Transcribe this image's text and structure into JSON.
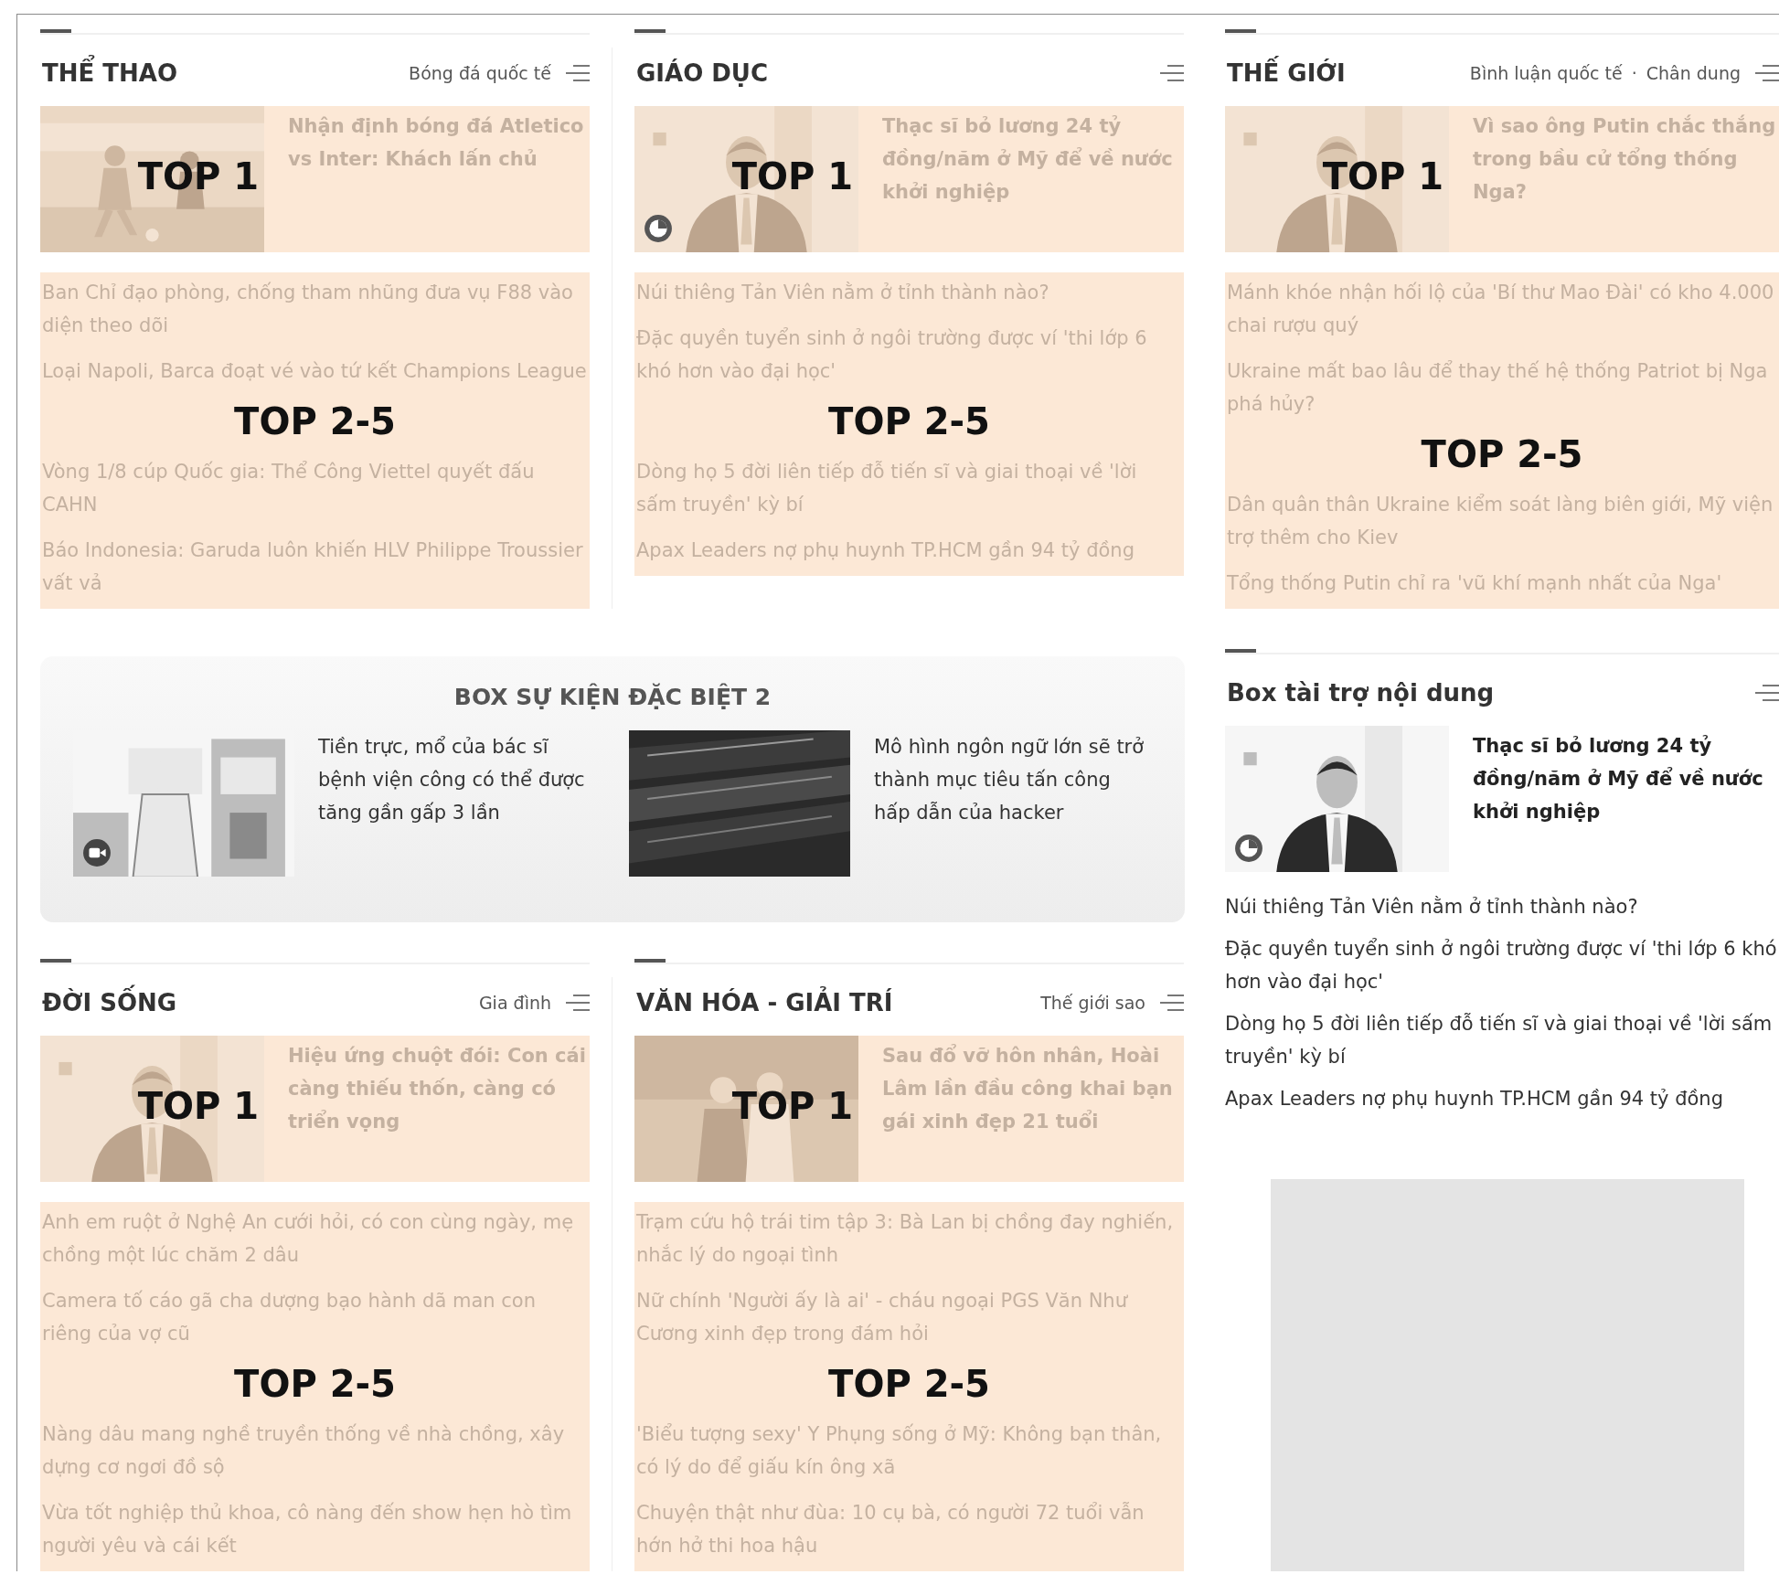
{
  "top_sections": [
    {
      "title": "THỂ THAO",
      "links": [
        "Bóng đá quốc tế"
      ],
      "top_story": {
        "headline": "Nhận định bóng đá Atletico vs Inter: Khách lấn chủ",
        "top_label": "TOP 1"
      },
      "list_label": "TOP 2-5",
      "stories": [
        "Ban Chỉ đạo phòng, chống tham nhũng đưa vụ F88 vào diện theo dõi",
        "Loại Napoli, Barca đoạt vé vào tứ kết Champions League",
        "Vòng 1/8 cúp Quốc gia: Thể Công Viettel quyết đấu CAHN",
        "Báo Indonesia: Garuda luôn khiến HLV Philippe Troussier vất vả"
      ]
    },
    {
      "title": "GIÁO DỤC",
      "top_story": {
        "headline": "Thạc sĩ bỏ lương 24 tỷ đồng/năm ở Mỹ để về nước khởi nghiệp",
        "top_label": "TOP 1",
        "badge": {
          "kind": "clock"
        }
      },
      "list_label": "TOP 2-5",
      "stories": [
        "Núi thiêng Tản Viên nằm ở tỉnh thành nào?",
        "Đặc quyền tuyển sinh ở ngôi trường được ví 'thi lớp 6 khó hơn vào đại học'",
        "Dòng họ 5 đời liên tiếp đỗ tiến sĩ và giai thoại về 'lời sấm truyền' kỳ bí",
        "Apax Leaders nợ phụ huynh TP.HCM gần 94 tỷ đồng"
      ]
    },
    {
      "title": "THẾ GIỚI",
      "links": [
        "Bình luận quốc tế",
        "Chân dung"
      ],
      "link_separator": "·",
      "top_story": {
        "headline": "Vì sao ông Putin chắc thắng trong bầu cử tổng thống Nga?",
        "top_label": "TOP 1"
      },
      "list_label": "TOP 2-5",
      "stories": [
        "Mánh khóe nhận hối lộ của 'Bí thư Mao Đài' có kho 4.000 chai rượu quý",
        "Ukraine mất bao lâu để thay thế hệ thống Patriot bị Nga phá hủy?",
        "Dân quân thân Ukraine kiểm soát làng biên giới, Mỹ viện trợ thêm cho Kiev",
        "Tổng thống Putin chỉ ra 'vũ khí mạnh nhất của Nga'"
      ]
    }
  ],
  "event_box": {
    "title": "BOX SỰ KIỆN ĐẶC BIỆT 2",
    "items": [
      {
        "headline": "Tiền trực, mổ của bác sĩ bệnh viện công có thể được tăng gần gấp 3 lần",
        "badge": {
          "kind": "video"
        }
      },
      {
        "headline": "Mô hình ngôn ngữ lớn sẽ trở thành mục tiêu tấn công hấp dẫn của hacker"
      }
    ]
  },
  "sponsor_box": {
    "title": "Box tài trợ nội dung",
    "top_story": {
      "headline": "Thạc sĩ bỏ lương 24 tỷ đồng/năm ở Mỹ để về nước khởi nghiệp",
      "badge": {
        "kind": "clock"
      }
    },
    "stories": [
      "Núi thiêng Tản Viên nằm ở tỉnh thành nào?",
      "Đặc quyền tuyển sinh ở ngôi trường được ví 'thi lớp 6 khó hơn vào đại học'",
      "Dòng họ 5 đời liên tiếp đỗ tiến sĩ và giai thoại về 'lời sấm truyền' kỳ bí",
      "Apax Leaders nợ phụ huynh TP.HCM gần 94 tỷ đồng"
    ]
  },
  "bottom_sections": [
    {
      "title": "ĐỜI SỐNG",
      "links": [
        "Gia đình"
      ],
      "top_story": {
        "headline": "Hiệu ứng chuột đói: Con cái càng thiếu thốn, càng có triển vọng",
        "top_label": "TOP 1"
      },
      "list_label": "TOP 2-5",
      "stories": [
        "Anh em ruột ở Nghệ An cưới hỏi, có con cùng ngày, mẹ chồng một lúc chăm 2 dâu",
        "Camera tố cáo gã cha dượng bạo hành dã man con riêng của vợ cũ",
        "Nàng dâu mang nghề truyền thống về nhà chồng, xây dựng cơ ngơi đồ sộ",
        "Vừa tốt nghiệp thủ khoa, cô nàng đến show hẹn hò tìm người yêu và cái kết"
      ]
    },
    {
      "title": "VĂN HÓA - GIẢI TRÍ",
      "links": [
        "Thế giới sao"
      ],
      "top_story": {
        "headline": "Sau đổ vỡ hôn nhân, Hoài Lâm lần đầu công khai bạn gái xinh đẹp 21 tuổi",
        "top_label": "TOP 1"
      },
      "list_label": "TOP 2-5",
      "stories": [
        "Trạm cứu hộ trái tim tập 3: Bà Lan bị chồng đay nghiến, nhắc lý do ngoại tình",
        "Nữ chính 'Người ấy là ai' - cháu ngoại PGS Văn Như Cương xinh đẹp trong đám hỏi",
        "'Biểu tượng sexy' Y Phụng sống ở Mỹ: Không bạn thân, có lý do để giấu kín ông xã",
        "Chuyện thật như đùa: 10 cụ bà, có người 72 tuổi vẫn hớn hở thi hoa hậu"
      ]
    }
  ]
}
